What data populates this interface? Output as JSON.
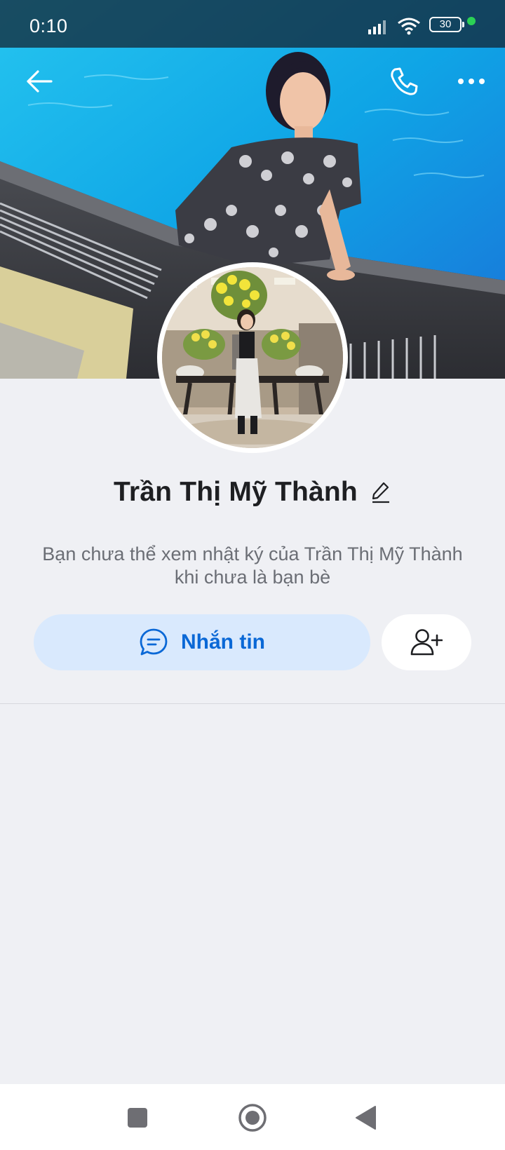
{
  "status_bar": {
    "time": "0:10",
    "battery": "30",
    "icons": [
      "signal-icon",
      "wifi-icon",
      "battery-icon",
      "dot-indicator"
    ]
  },
  "toolbar": {
    "back_icon": "arrow-left-icon",
    "call_icon": "phone-icon",
    "more_icon": "more-horizontal-icon"
  },
  "profile": {
    "name": "Trần Thị Mỹ Thành",
    "edit_icon": "pencil-icon",
    "notice_line1": "Bạn chưa thể xem nhật ký của Trần Thị Mỹ Thành",
    "notice_line2": "khi chưa là bạn bè"
  },
  "actions": {
    "message_label": "Nhắn tin",
    "message_icon": "chat-bubble-icon",
    "add_friend_icon": "add-user-icon"
  },
  "colors": {
    "accent": "#0a68d6",
    "message_bg": "#d9e9fd",
    "page_bg": "#eff0f4"
  },
  "nav": {
    "recent_icon": "square-icon",
    "home_icon": "circle-icon",
    "back_icon": "triangle-back-icon"
  }
}
